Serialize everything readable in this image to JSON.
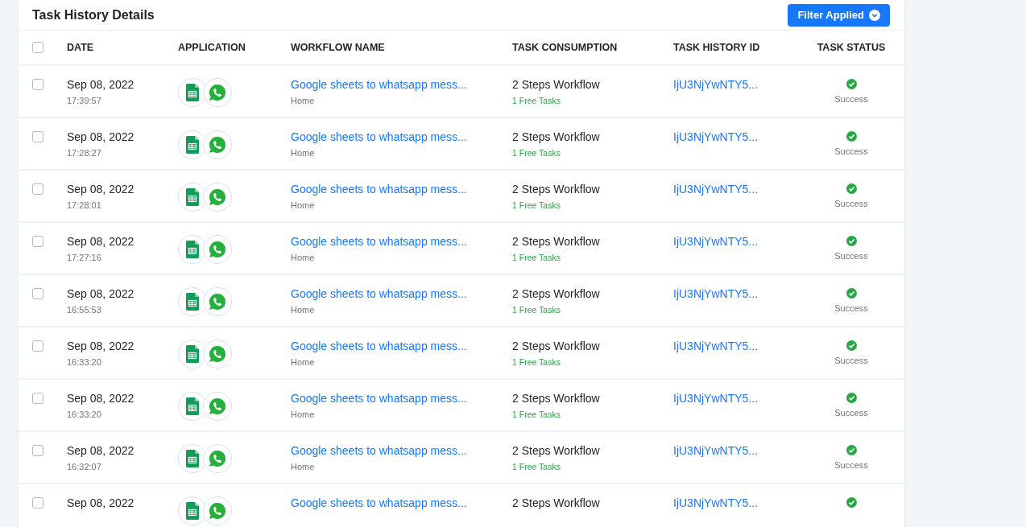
{
  "header": {
    "title": "Task History Details",
    "filter_button": {
      "label": "Filter Applied"
    }
  },
  "table": {
    "select_all": {
      "checked": false
    },
    "columns": [
      "DATE",
      "APPLICATION",
      "WORKFLOW NAME",
      "TASK CONSUMPTION",
      "TASK HISTORY ID",
      "TASK STATUS"
    ],
    "rows": [
      {
        "checked": false,
        "date": "Sep 08, 2022",
        "time": "17:39:57",
        "apps": [
          {
            "kind": "sheets"
          },
          {
            "kind": "whatsapp"
          }
        ],
        "workflow_name": "Google sheets to whatsapp mess...",
        "folder": "Home",
        "consumption": "2 Steps Workflow",
        "free_tasks": "1 Free Tasks",
        "task_history_id": "IjU3NjYwNTY5...",
        "status": {
          "kind": "success",
          "label": "Success"
        }
      },
      {
        "checked": false,
        "date": "Sep 08, 2022",
        "time": "17:28:27",
        "apps": [
          {
            "kind": "sheets"
          },
          {
            "kind": "whatsapp"
          }
        ],
        "workflow_name": "Google sheets to whatsapp mess...",
        "folder": "Home",
        "consumption": "2 Steps Workflow",
        "free_tasks": "1 Free Tasks",
        "task_history_id": "IjU3NjYwNTY5...",
        "status": {
          "kind": "success",
          "label": "Success"
        }
      },
      {
        "checked": false,
        "date": "Sep 08, 2022",
        "time": "17:28:01",
        "apps": [
          {
            "kind": "sheets"
          },
          {
            "kind": "whatsapp"
          }
        ],
        "workflow_name": "Google sheets to whatsapp mess...",
        "folder": "Home",
        "consumption": "2 Steps Workflow",
        "free_tasks": "1 Free Tasks",
        "task_history_id": "IjU3NjYwNTY5...",
        "status": {
          "kind": "success",
          "label": "Success"
        }
      },
      {
        "checked": false,
        "date": "Sep 08, 2022",
        "time": "17:27:16",
        "apps": [
          {
            "kind": "sheets"
          },
          {
            "kind": "whatsapp"
          }
        ],
        "workflow_name": "Google sheets to whatsapp mess...",
        "folder": "Home",
        "consumption": "2 Steps Workflow",
        "free_tasks": "1 Free Tasks",
        "task_history_id": "IjU3NjYwNTY5...",
        "status": {
          "kind": "success",
          "label": "Success"
        }
      },
      {
        "checked": false,
        "date": "Sep 08, 2022",
        "time": "16:55:53",
        "apps": [
          {
            "kind": "sheets"
          },
          {
            "kind": "whatsapp"
          }
        ],
        "workflow_name": "Google sheets to whatsapp mess...",
        "folder": "Home",
        "consumption": "2 Steps Workflow",
        "free_tasks": "1 Free Tasks",
        "task_history_id": "IjU3NjYwNTY5...",
        "status": {
          "kind": "success",
          "label": "Success"
        }
      },
      {
        "checked": false,
        "date": "Sep 08, 2022",
        "time": "16:33:20",
        "apps": [
          {
            "kind": "sheets"
          },
          {
            "kind": "whatsapp"
          }
        ],
        "workflow_name": "Google sheets to whatsapp mess...",
        "folder": "Home",
        "consumption": "2 Steps Workflow",
        "free_tasks": "1 Free Tasks",
        "task_history_id": "IjU3NjYwNTY5...",
        "status": {
          "kind": "success",
          "label": "Success"
        }
      },
      {
        "checked": false,
        "date": "Sep 08, 2022",
        "time": "16:33:20",
        "apps": [
          {
            "kind": "sheets"
          },
          {
            "kind": "whatsapp"
          }
        ],
        "workflow_name": "Google sheets to whatsapp mess...",
        "folder": "Home",
        "consumption": "2 Steps Workflow",
        "free_tasks": "1 Free Tasks",
        "task_history_id": "IjU3NjYwNTY5...",
        "status": {
          "kind": "success",
          "label": "Success"
        }
      },
      {
        "checked": false,
        "date": "Sep 08, 2022",
        "time": "16:32:07",
        "apps": [
          {
            "kind": "sheets"
          },
          {
            "kind": "whatsapp"
          }
        ],
        "workflow_name": "Google sheets to whatsapp mess...",
        "folder": "Home",
        "consumption": "2 Steps Workflow",
        "free_tasks": "1 Free Tasks",
        "task_history_id": "IjU3NjYwNTY5...",
        "status": {
          "kind": "success",
          "label": "Success"
        }
      },
      {
        "checked": false,
        "date": "Sep 08, 2022",
        "apps": [
          {
            "kind": "sheets"
          },
          {
            "kind": "whatsapp"
          }
        ],
        "workflow_name": "Google sheets to whatsapp mess...",
        "consumption": "2 Steps Workflow",
        "task_history_id": "IjU3NjYwNTY5...",
        "status": {
          "kind": "success"
        }
      }
    ]
  }
}
